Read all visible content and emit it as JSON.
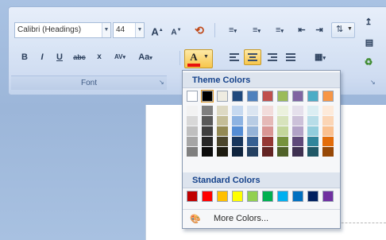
{
  "ribbon": {
    "font_name": "Calibri (Headings)",
    "font_size": "44",
    "grow_font": "A",
    "shrink_font": "A",
    "bold": "B",
    "italic": "I",
    "underline": "U",
    "strikethrough": "abc",
    "subscript": "x",
    "char_spacing": "AV",
    "change_case": "Aa",
    "font_color_letter": "A",
    "group_label": "Font"
  },
  "color_panel": {
    "theme_heading": "Theme Colors",
    "standard_heading": "Standard Colors",
    "more_colors_label": "More Colors...",
    "theme_colors": [
      {
        "name": "white",
        "base": "#ffffff",
        "shades": [
          "#f2f2f2",
          "#d8d8d8",
          "#bfbfbf",
          "#a5a5a5",
          "#7f7f7f"
        ]
      },
      {
        "name": "black",
        "base": "#000000",
        "shades": [
          "#7f7f7f",
          "#595959",
          "#3f3f3f",
          "#262626",
          "#0c0c0c"
        ],
        "selected": true
      },
      {
        "name": "tan",
        "base": "#eeece1",
        "shades": [
          "#ddd9c3",
          "#c4bd97",
          "#938953",
          "#4a442a",
          "#1d1b10"
        ]
      },
      {
        "name": "dark-blue",
        "base": "#1f497d",
        "shades": [
          "#c6d9f0",
          "#8db3e2",
          "#548dd4",
          "#17365d",
          "#0f243e"
        ]
      },
      {
        "name": "blue",
        "base": "#4f81bd",
        "shades": [
          "#dbe5f1",
          "#b8cce4",
          "#95b3d7",
          "#366092",
          "#244061"
        ]
      },
      {
        "name": "red",
        "base": "#c0504d",
        "shades": [
          "#f2dcdb",
          "#e5b9b7",
          "#d99694",
          "#953734",
          "#632423"
        ]
      },
      {
        "name": "green",
        "base": "#9bbb59",
        "shades": [
          "#ebf1dd",
          "#d7e3bc",
          "#c3d69b",
          "#76923c",
          "#4f6128"
        ]
      },
      {
        "name": "purple",
        "base": "#8064a2",
        "shades": [
          "#e5e0ec",
          "#ccc1d9",
          "#b2a2c7",
          "#5f497a",
          "#3f3151"
        ]
      },
      {
        "name": "aqua",
        "base": "#4bacc6",
        "shades": [
          "#dbeef3",
          "#b7dde8",
          "#92cddc",
          "#31859b",
          "#205867"
        ]
      },
      {
        "name": "orange",
        "base": "#f79646",
        "shades": [
          "#fdeada",
          "#fbd5b5",
          "#fac08f",
          "#e36c09",
          "#974806"
        ]
      }
    ],
    "standard_colors": [
      "#c00000",
      "#ff0000",
      "#ffc000",
      "#ffff00",
      "#92d050",
      "#00b050",
      "#00b0f0",
      "#0070c0",
      "#002060",
      "#7030a0"
    ]
  }
}
